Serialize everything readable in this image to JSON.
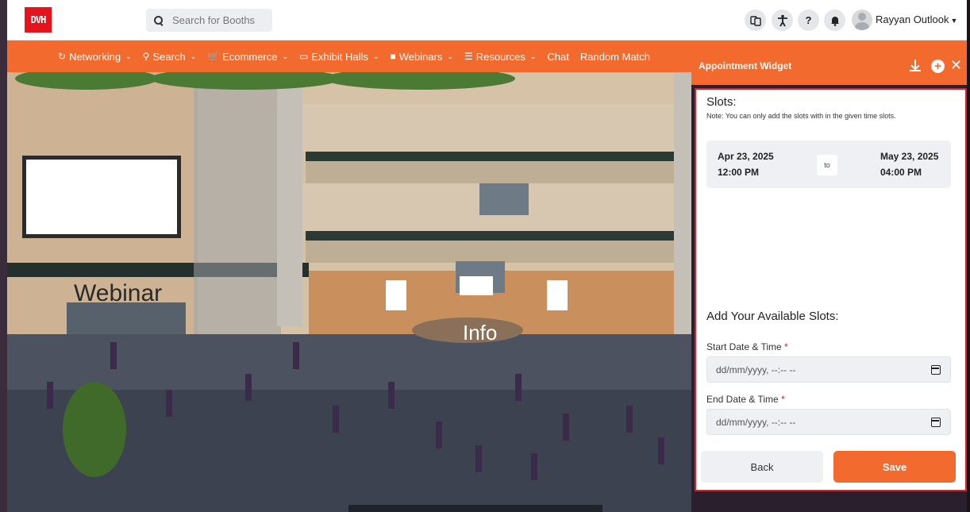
{
  "header": {
    "logo_text": "DVH",
    "search_placeholder": "Search for Booths",
    "user_name": "Rayyan Outlook",
    "help_label": "?"
  },
  "nav": {
    "items": [
      {
        "label": "Networking",
        "icon": "networking-icon",
        "dropdown": true
      },
      {
        "label": "Search",
        "icon": "search-icon",
        "dropdown": true
      },
      {
        "label": "Ecommerce",
        "icon": "cart-icon",
        "dropdown": true
      },
      {
        "label": "Exhibit Halls",
        "icon": "exhibit-icon",
        "dropdown": true
      },
      {
        "label": "Webinars",
        "icon": "video-icon",
        "dropdown": true
      },
      {
        "label": "Resources",
        "icon": "list-icon",
        "dropdown": true
      },
      {
        "label": "Chat",
        "icon": "",
        "dropdown": false
      },
      {
        "label": "Random Match",
        "icon": "",
        "dropdown": false
      }
    ]
  },
  "scene": {
    "webinar_sign": "Webinar",
    "info_sign": "Info"
  },
  "widget": {
    "title": "Appointment Widget",
    "slots_title": "Slots:",
    "slots_note": "Note: You can only add the slots with in the given time slots.",
    "slot": {
      "start_date": "Apr 23, 2025",
      "start_time": "12:00 PM",
      "separator": "to",
      "end_date": "May 23, 2025",
      "end_time": "04:00 PM"
    },
    "add_title": "Add Your Available Slots:",
    "start_label": "Start Date & Time",
    "end_label": "End Date & Time",
    "required_mark": "*",
    "date_placeholder": "dd/mm/yyyy, --:-- --",
    "back_label": "Back",
    "save_label": "Save"
  },
  "colors": {
    "accent": "#f26a2e",
    "highlight_border": "#d9222a",
    "logo": "#e3141b"
  }
}
